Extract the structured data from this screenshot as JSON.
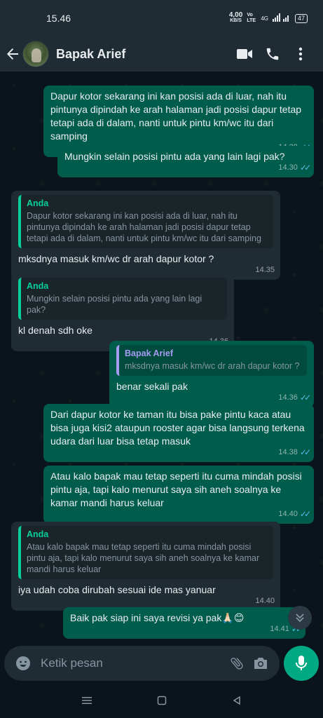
{
  "status": {
    "time": "15.46",
    "net_speed": "4,00",
    "net_unit": "KB/S",
    "volte": "Vo LTE",
    "signal": "4G",
    "battery": "47"
  },
  "header": {
    "contact_name": "Bapak Arief"
  },
  "messages": [
    {
      "dir": "out",
      "text": "Dapur kotor sekarang ini kan posisi ada di luar, nah itu pintunya dipindah ke arah halaman jadi posisi dapur tetap tetapi ada di dalam, nanti untuk pintu km/wc itu dari samping",
      "time": "14.28"
    },
    {
      "dir": "out",
      "text": "Mungkin selain posisi pintu ada yang lain lagi pak?",
      "time": "14.30"
    },
    {
      "dir": "in",
      "quote_author": "Anda",
      "quote_text": "Dapur kotor sekarang ini kan posisi ada di luar, nah itu pintunya dipindah ke arah halaman jadi posisi dapur tetap tetapi ada di dalam, nanti untuk pintu km/wc itu dari samping",
      "text": "mksdnya masuk km/wc dr arah dapur kotor ?",
      "time": "14.35"
    },
    {
      "dir": "in",
      "quote_author": "Anda",
      "quote_text": "Mungkin selain posisi pintu ada yang lain lagi pak?",
      "text": "kl denah sdh oke",
      "time": "14.36"
    },
    {
      "dir": "out",
      "quote_author": "Bapak Arief",
      "quote_text": "mksdnya masuk km/wc dr arah dapur kotor ?",
      "text": "benar sekali pak",
      "time": "14.36"
    },
    {
      "dir": "out",
      "text": "Dari dapur kotor ke taman itu bisa pake pintu kaca atau bisa juga kisi2 ataupun rooster agar bisa langsung terkena udara dari luar bisa tetap masuk",
      "time": "14.38"
    },
    {
      "dir": "out",
      "text": "Atau kalo bapak mau tetap seperti itu cuma mindah posisi pintu aja, tapi kalo menurut saya sih aneh soalnya ke kamar mandi harus keluar",
      "time": "14.40"
    },
    {
      "dir": "in",
      "quote_author": "Anda",
      "quote_text": "Atau kalo bapak mau tetap seperti itu cuma mindah posisi pintu aja, tapi kalo menurut saya sih aneh soalnya ke kamar mandi harus keluar",
      "text": "iya udah coba dirubah sesuai ide mas yanuar",
      "time": "14.40"
    },
    {
      "dir": "out",
      "text": "Baik pak siap ini saya revisi ya pak🙏🏻😊",
      "time": "14.41"
    }
  ],
  "ticks_glyph": "✓✓",
  "input": {
    "placeholder": "Ketik pesan"
  },
  "colors": {
    "outgoing_bubble": "#005c4b",
    "incoming_bubble": "#202c33",
    "accent": "#00a884",
    "read_ticks": "#53bdeb"
  }
}
